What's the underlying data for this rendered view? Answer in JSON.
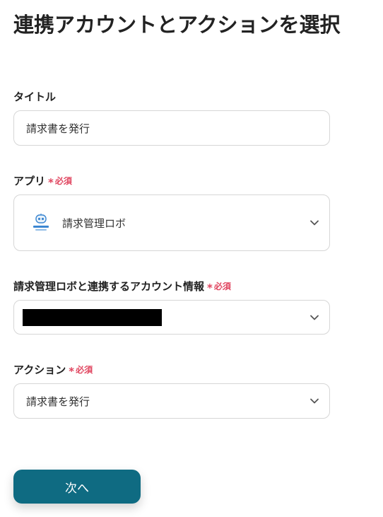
{
  "page_title": "連携アカウントとアクションを選択",
  "required_label": "必須",
  "required_mark": "*",
  "colors": {
    "required": "#e0455f",
    "primary_button": "#0f6b82",
    "border": "#d6d6d6"
  },
  "fields": {
    "title": {
      "label": "タイトル",
      "value": "請求書を発行"
    },
    "app": {
      "label": "アプリ",
      "value": "請求管理ロボ",
      "icon": "robot-logo-icon"
    },
    "account": {
      "label": "請求管理ロボと連携するアカウント情報",
      "value_redacted": true,
      "icon": "chevron-down-icon"
    },
    "action": {
      "label": "アクション",
      "value": "請求書を発行",
      "icon": "chevron-down-icon"
    }
  },
  "next_button": {
    "label": "次へ"
  }
}
